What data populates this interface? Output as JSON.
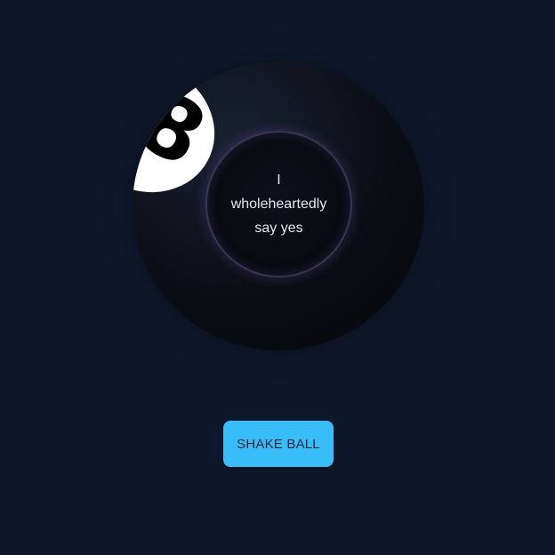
{
  "ball": {
    "number": "8",
    "answer_lines": [
      "I",
      "wholeheartedly",
      "say yes"
    ]
  },
  "controls": {
    "shake_label": "SHAKE BALL"
  },
  "colors": {
    "background": "#0f172a",
    "ball": "#0a0d14",
    "button": "#38bdf8",
    "button_text": "#1e293b",
    "window_ring": "#3b3452"
  }
}
